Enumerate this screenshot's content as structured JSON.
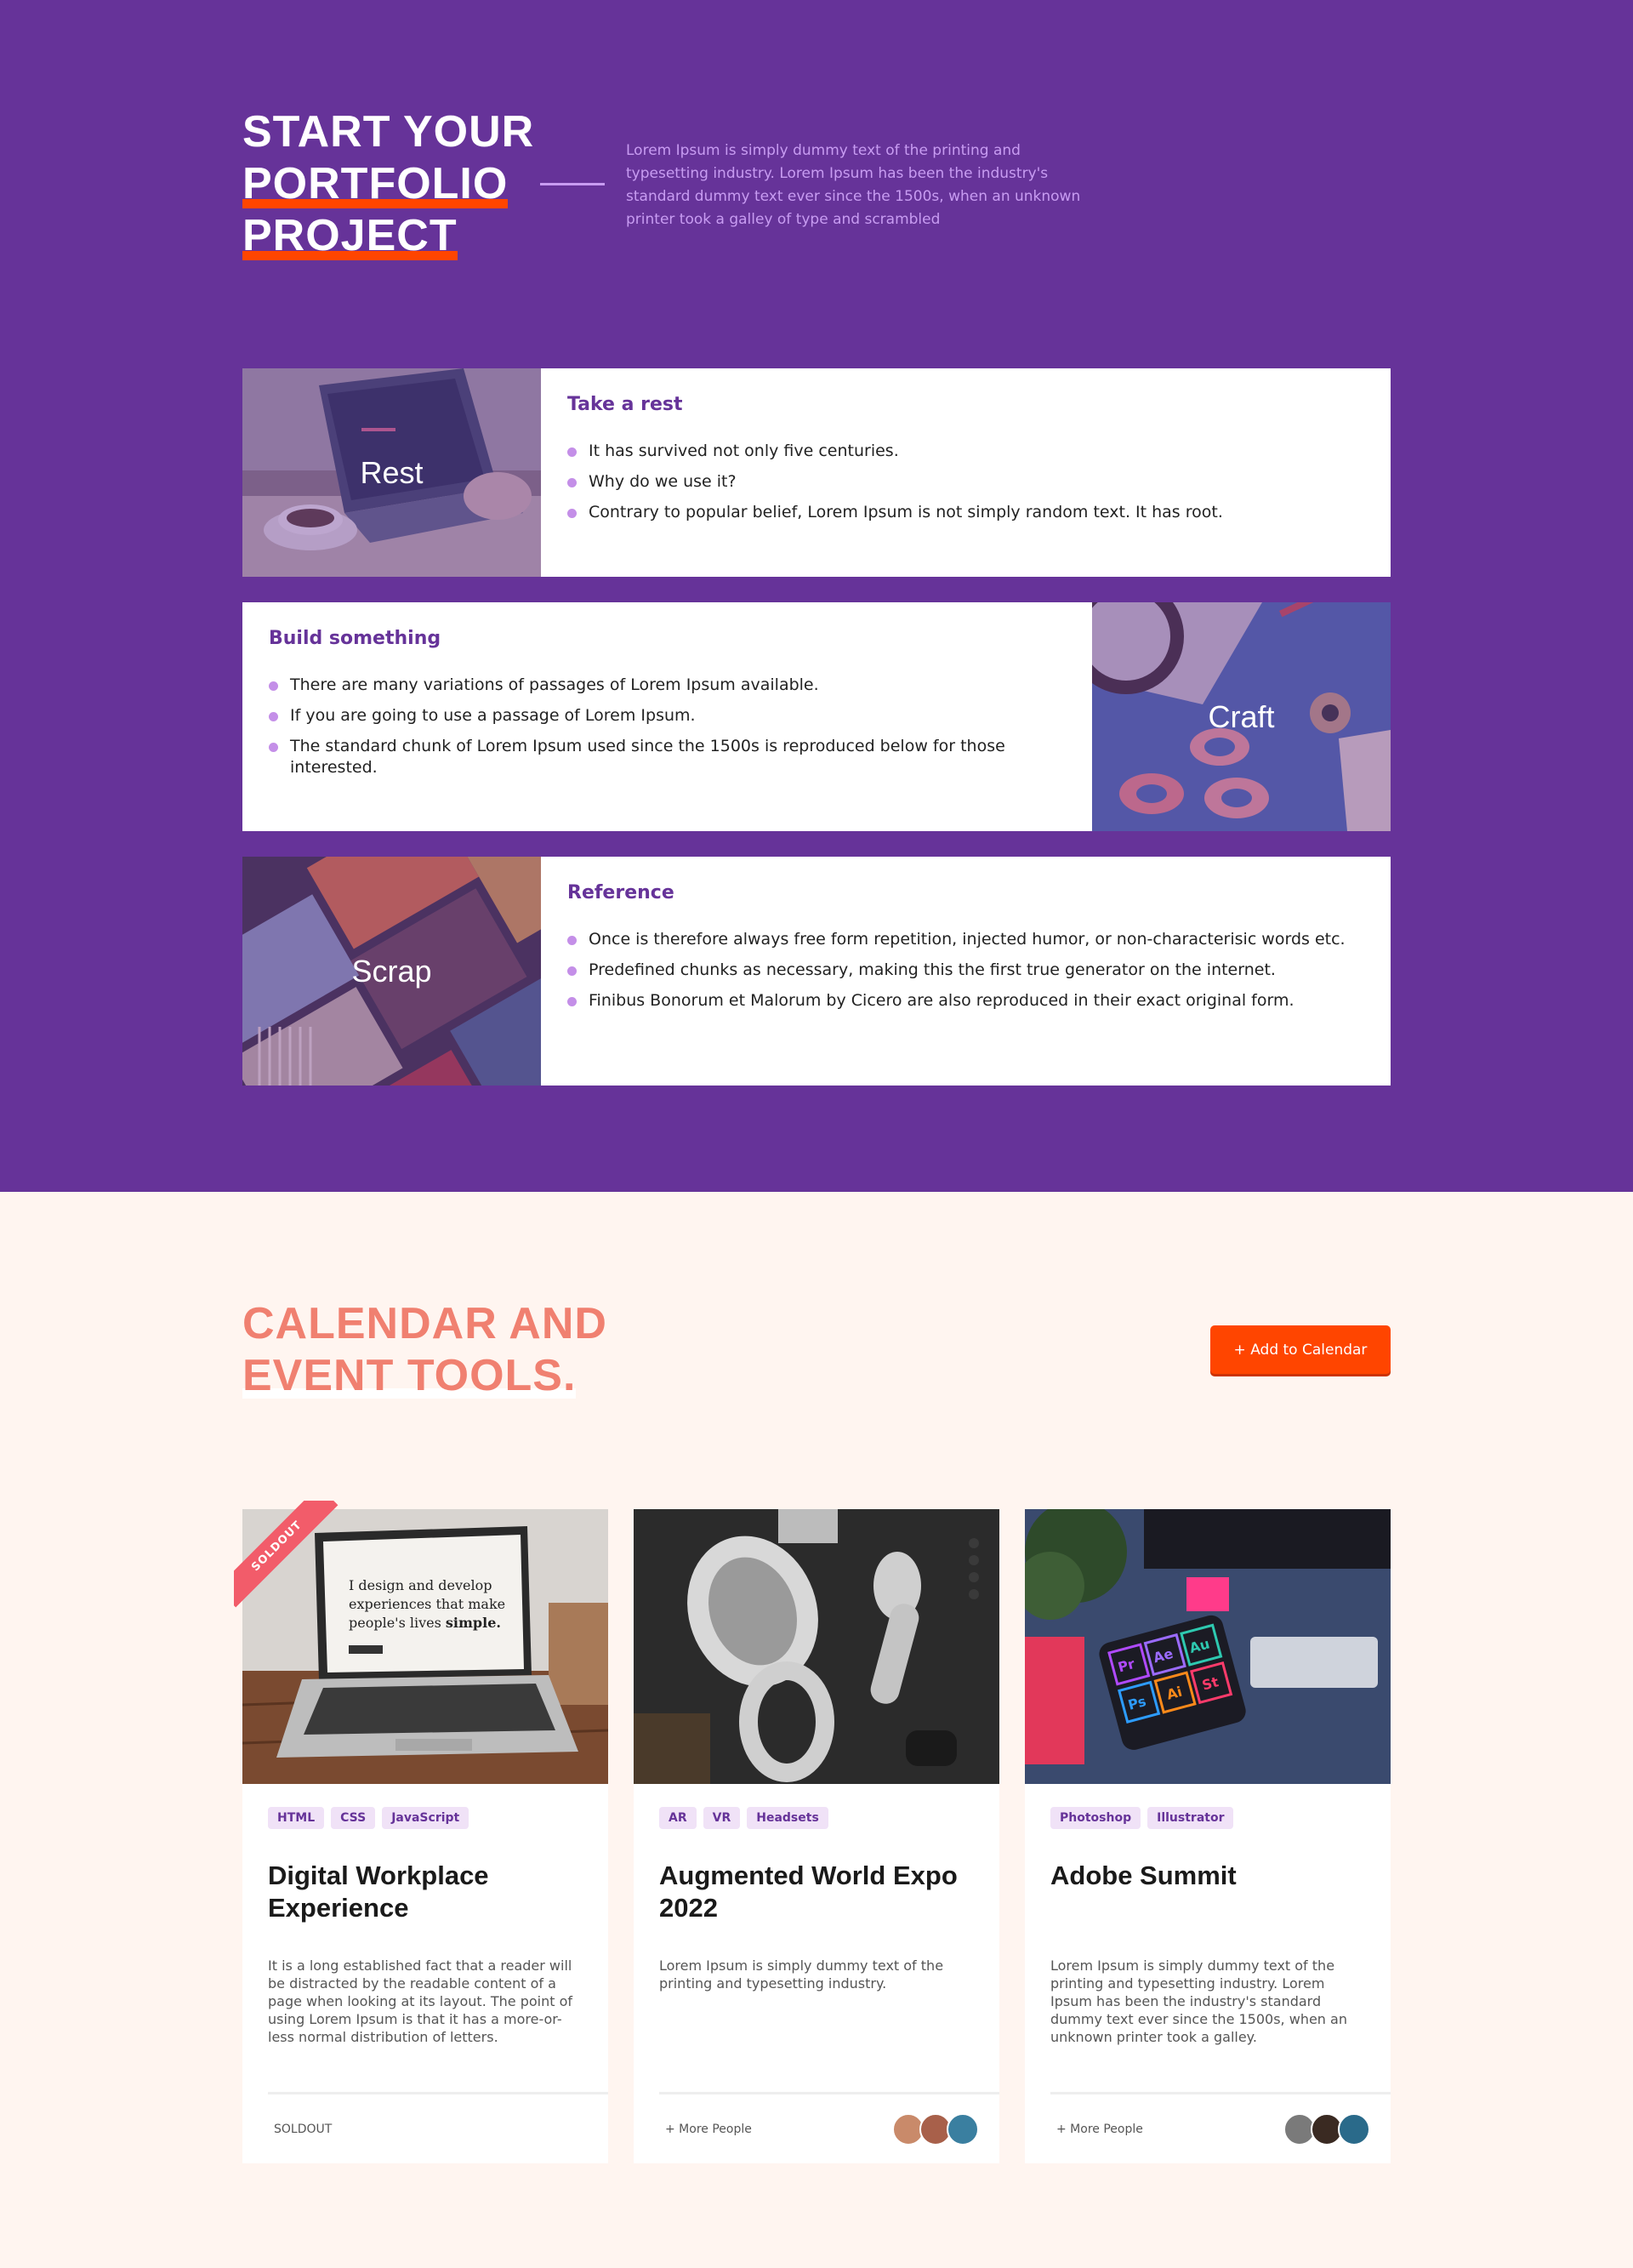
{
  "hero": {
    "title_line1": "START YOUR",
    "title_line2": "PORTFOLIO",
    "title_line3": "PROJECT",
    "description": "Lorem Ipsum is simply dummy text of the printing and typesetting industry. Lorem Ipsum has been the industry's standard dummy text ever since the 1500s, when an unknown printer took a galley of type and scrambled",
    "colors": {
      "background": "#663399",
      "highlight": "#ff4500",
      "accent": "#c89cf2"
    }
  },
  "features": [
    {
      "image_caption": "Rest",
      "heading": "Take a rest",
      "items": [
        "It has survived not only five centuries.",
        "Why do we use it?",
        "Contrary to popular belief, Lorem Ipsum is not simply random text. It has root."
      ]
    },
    {
      "image_caption": "Craft",
      "heading": "Build something",
      "items": [
        "There are many variations of passages of Lorem Ipsum available.",
        "If you are going to use a passage of Lorem Ipsum.",
        "The standard chunk of Lorem Ipsum used since the 1500s is reproduced below for those interested."
      ]
    },
    {
      "image_caption": "Scrap",
      "heading": "Reference",
      "items": [
        "Once is therefore always free form repetition, injected humor, or non-characterisic words etc.",
        "Predefined chunks as necessary, making this the first true generator on the internet.",
        "Finibus Bonorum et Malorum by Cicero are also reproduced in their exact original form."
      ]
    }
  ],
  "calendar": {
    "title_line1": "CALENDAR AND",
    "title_line2": "EVENT TOOLS.",
    "add_button_label": "+ Add to Calendar",
    "colors": {
      "title": "#f08070",
      "button": "#ff4500",
      "background": "#fff5f0"
    }
  },
  "events": [
    {
      "ribbon": "SOLDOUT",
      "screen_text": "I design and develop experiences that make people's lives simple.",
      "tags": [
        "HTML",
        "CSS",
        "JavaScript"
      ],
      "title": "Digital Workplace Experience",
      "description": "It is a long established fact that a reader will be distracted by the readable content of a page when looking at its layout. The point of using Lorem Ipsum is that it has a more-or-less normal distribution of letters.",
      "footer": "SOLDOUT"
    },
    {
      "tags": [
        "AR",
        "VR",
        "Headsets"
      ],
      "title": "Augmented World Expo 2022",
      "description": "Lorem Ipsum is simply dummy text of the printing and typesetting industry.",
      "footer": "+ More People"
    },
    {
      "app_icons": [
        "Pr",
        "Ae",
        "Au",
        "Ps",
        "Ai",
        "St"
      ],
      "tags": [
        "Photoshop",
        "Illustrator"
      ],
      "title": "Adobe Summit",
      "description": "Lorem Ipsum is simply dummy text of the printing and typesetting industry. Lorem Ipsum has been the industry's standard dummy text ever since the 1500s, when an unknown printer took a galley.",
      "footer": "+ More People"
    }
  ]
}
